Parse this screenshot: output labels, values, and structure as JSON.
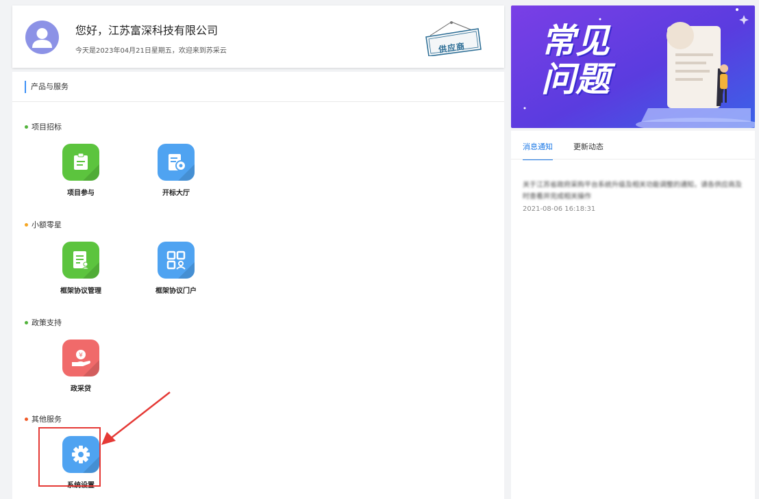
{
  "header": {
    "greeting": "您好，江苏富深科技有限公司",
    "date_line": "今天是2023年04月21日星期五，欢迎来到苏采云",
    "badge": "供应商"
  },
  "services": {
    "title": "产品与服务",
    "categories": [
      {
        "label": "项目招标",
        "dot_color": "#52b33b",
        "items": [
          {
            "label": "项目参与",
            "icon": "clipboard-icon",
            "color": "#5cc43e"
          },
          {
            "label": "开标大厅",
            "icon": "certificate-icon",
            "color": "#4fa3f1"
          }
        ]
      },
      {
        "label": "小额零星",
        "dot_color": "#f5a623",
        "items": [
          {
            "label": "框架协议管理",
            "icon": "document-user-icon",
            "color": "#5cc43e"
          },
          {
            "label": "框架协议门户",
            "icon": "portal-grid-icon",
            "color": "#4fa3f1"
          }
        ]
      },
      {
        "label": "政策支持",
        "dot_color": "#52b33b",
        "items": [
          {
            "label": "政采贷",
            "icon": "loan-hand-icon",
            "color": "#f06a6a"
          }
        ]
      },
      {
        "label": "其他服务",
        "dot_color": "#f05a28",
        "items": [
          {
            "label": "系统设置",
            "icon": "gear-icon",
            "color": "#4fa3f1"
          }
        ]
      }
    ]
  },
  "banner": {
    "title": "常见\n问题"
  },
  "news": {
    "tabs": [
      "消息通知",
      "更新动态"
    ],
    "item": {
      "title": "关于江苏省政府采购平台系统升级及相关功能调整的通知，请各供应商及时查看并完成相关操作",
      "time": "2021-08-06 16:18:31"
    }
  },
  "colors": {
    "accent": "#1b78e6",
    "highlight": "#e53935"
  }
}
